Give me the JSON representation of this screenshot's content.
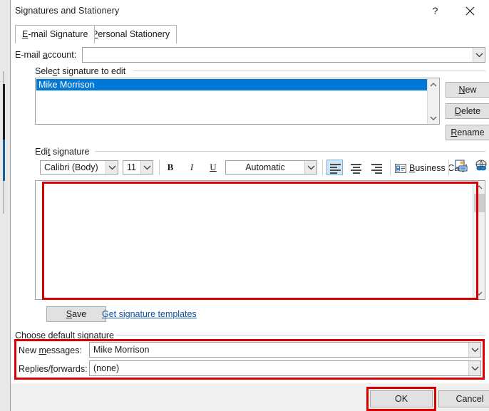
{
  "window": {
    "title": "Signatures and Stationery",
    "help_icon": "question-mark-icon",
    "close_icon": "close-icon"
  },
  "tabs": [
    {
      "label": "E-mail Signature",
      "accel": "E",
      "selected": true
    },
    {
      "label": "Personal Stationery",
      "accel": "P",
      "selected": false
    }
  ],
  "email_account": {
    "label": "E-mail account:",
    "accel": "a",
    "value": "",
    "placeholder": ""
  },
  "select_signature": {
    "group_label": "Select signature to edit",
    "accel": "c",
    "items": [
      {
        "label": "Mike Morrison",
        "selected": true
      }
    ],
    "selection_color": "#0078d7",
    "buttons": [
      {
        "label": "New",
        "accel": "N",
        "name": "new-signature-button"
      },
      {
        "label": "Delete",
        "accel": "D",
        "name": "delete-signature-button"
      },
      {
        "label": "Rename",
        "accel": "R",
        "name": "rename-signature-button"
      }
    ]
  },
  "edit_signature": {
    "group_label": "Edit signature",
    "accel": "t",
    "toolbar": {
      "font_family": "Calibri (Body)",
      "font_size": "11",
      "bold": "B",
      "italic": "I",
      "underline": "U",
      "font_color": "Automatic",
      "align_left": "align-left-icon",
      "align_center": "align-center-icon",
      "align_right": "align-right-icon",
      "align_active": "left",
      "business_card": "Business Card",
      "business_card_accel": "B",
      "picture": "insert-picture-icon",
      "hyperlink": "insert-hyperlink-icon"
    },
    "content": "",
    "save_button": "Save",
    "save_accel": "S",
    "templates_link": "Get signature templates",
    "link_color": "#1254a0"
  },
  "default_signature": {
    "group_label": "Choose default signature",
    "rows": [
      {
        "label": "New messages:",
        "accel": "m",
        "value": "Mike Morrison"
      },
      {
        "label": "Replies/forwards:",
        "accel": "f",
        "value": "(none)"
      }
    ]
  },
  "footer": {
    "ok": "OK",
    "cancel": "Cancel"
  },
  "annotations": {
    "color": "#d70000",
    "boxes": [
      "edit-signature-area",
      "choose-default-signature-rows",
      "ok-button"
    ]
  }
}
